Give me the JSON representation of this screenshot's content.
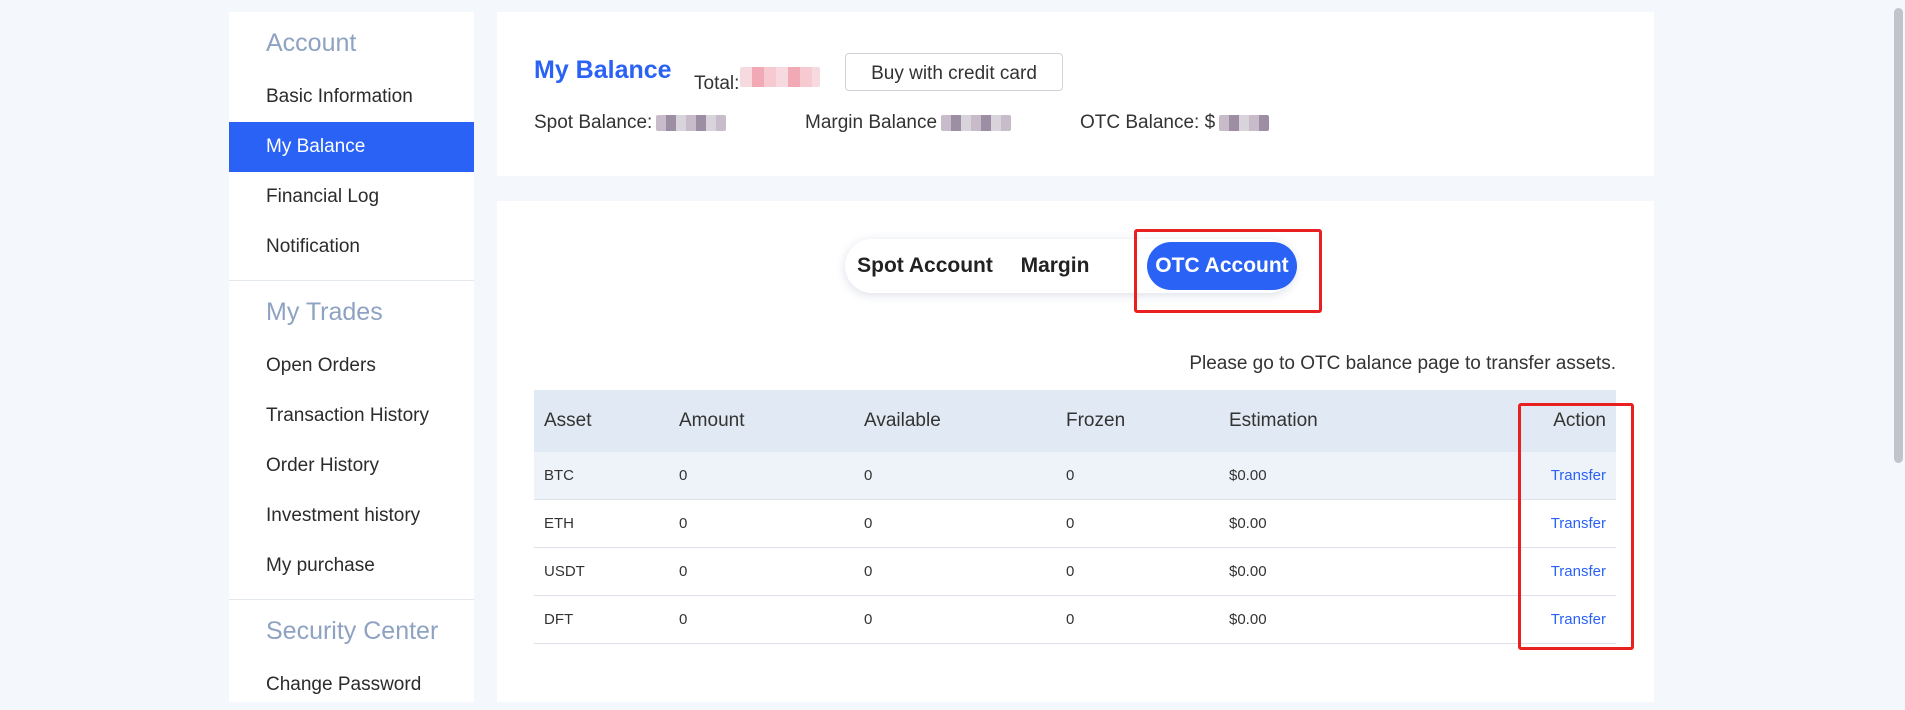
{
  "sidebar": {
    "sections": [
      {
        "heading": "Account",
        "items": [
          "Basic Information",
          "My Balance",
          "Financial Log",
          "Notification"
        ]
      },
      {
        "heading": "My Trades",
        "items": [
          "Open Orders",
          "Transaction History",
          "Order History",
          "Investment history",
          "My purchase"
        ]
      },
      {
        "heading": "Security Center",
        "items": [
          "Change Password"
        ]
      }
    ],
    "active_item": "My Balance"
  },
  "balance": {
    "title": "My Balance",
    "total_label": "Total:",
    "buy_button": "Buy with credit card",
    "spot_label": "Spot Balance:",
    "margin_label": "Margin Balance",
    "otc_label": "OTC Balance: $"
  },
  "tabs": {
    "items": [
      "Spot Account",
      "Margin",
      "OTC Account"
    ],
    "active": "OTC Account"
  },
  "notice": "Please go to OTC balance page to transfer assets.",
  "table": {
    "headers": [
      "Asset",
      "Amount",
      "Available",
      "Frozen",
      "Estimation",
      "Action"
    ],
    "rows": [
      {
        "asset": "BTC",
        "amount": "0",
        "available": "0",
        "frozen": "0",
        "estimation": "$0.00",
        "action": "Transfer"
      },
      {
        "asset": "ETH",
        "amount": "0",
        "available": "0",
        "frozen": "0",
        "estimation": "$0.00",
        "action": "Transfer"
      },
      {
        "asset": "USDT",
        "amount": "0",
        "available": "0",
        "frozen": "0",
        "estimation": "$0.00",
        "action": "Transfer"
      },
      {
        "asset": "DFT",
        "amount": "0",
        "available": "0",
        "frozen": "0",
        "estimation": "$0.00",
        "action": "Transfer"
      }
    ]
  },
  "colors": {
    "accent": "#2a62f6",
    "highlight": "#e8201f",
    "sidebar_heading": "#8ea2c2",
    "table_header": "#e1e9f4"
  }
}
